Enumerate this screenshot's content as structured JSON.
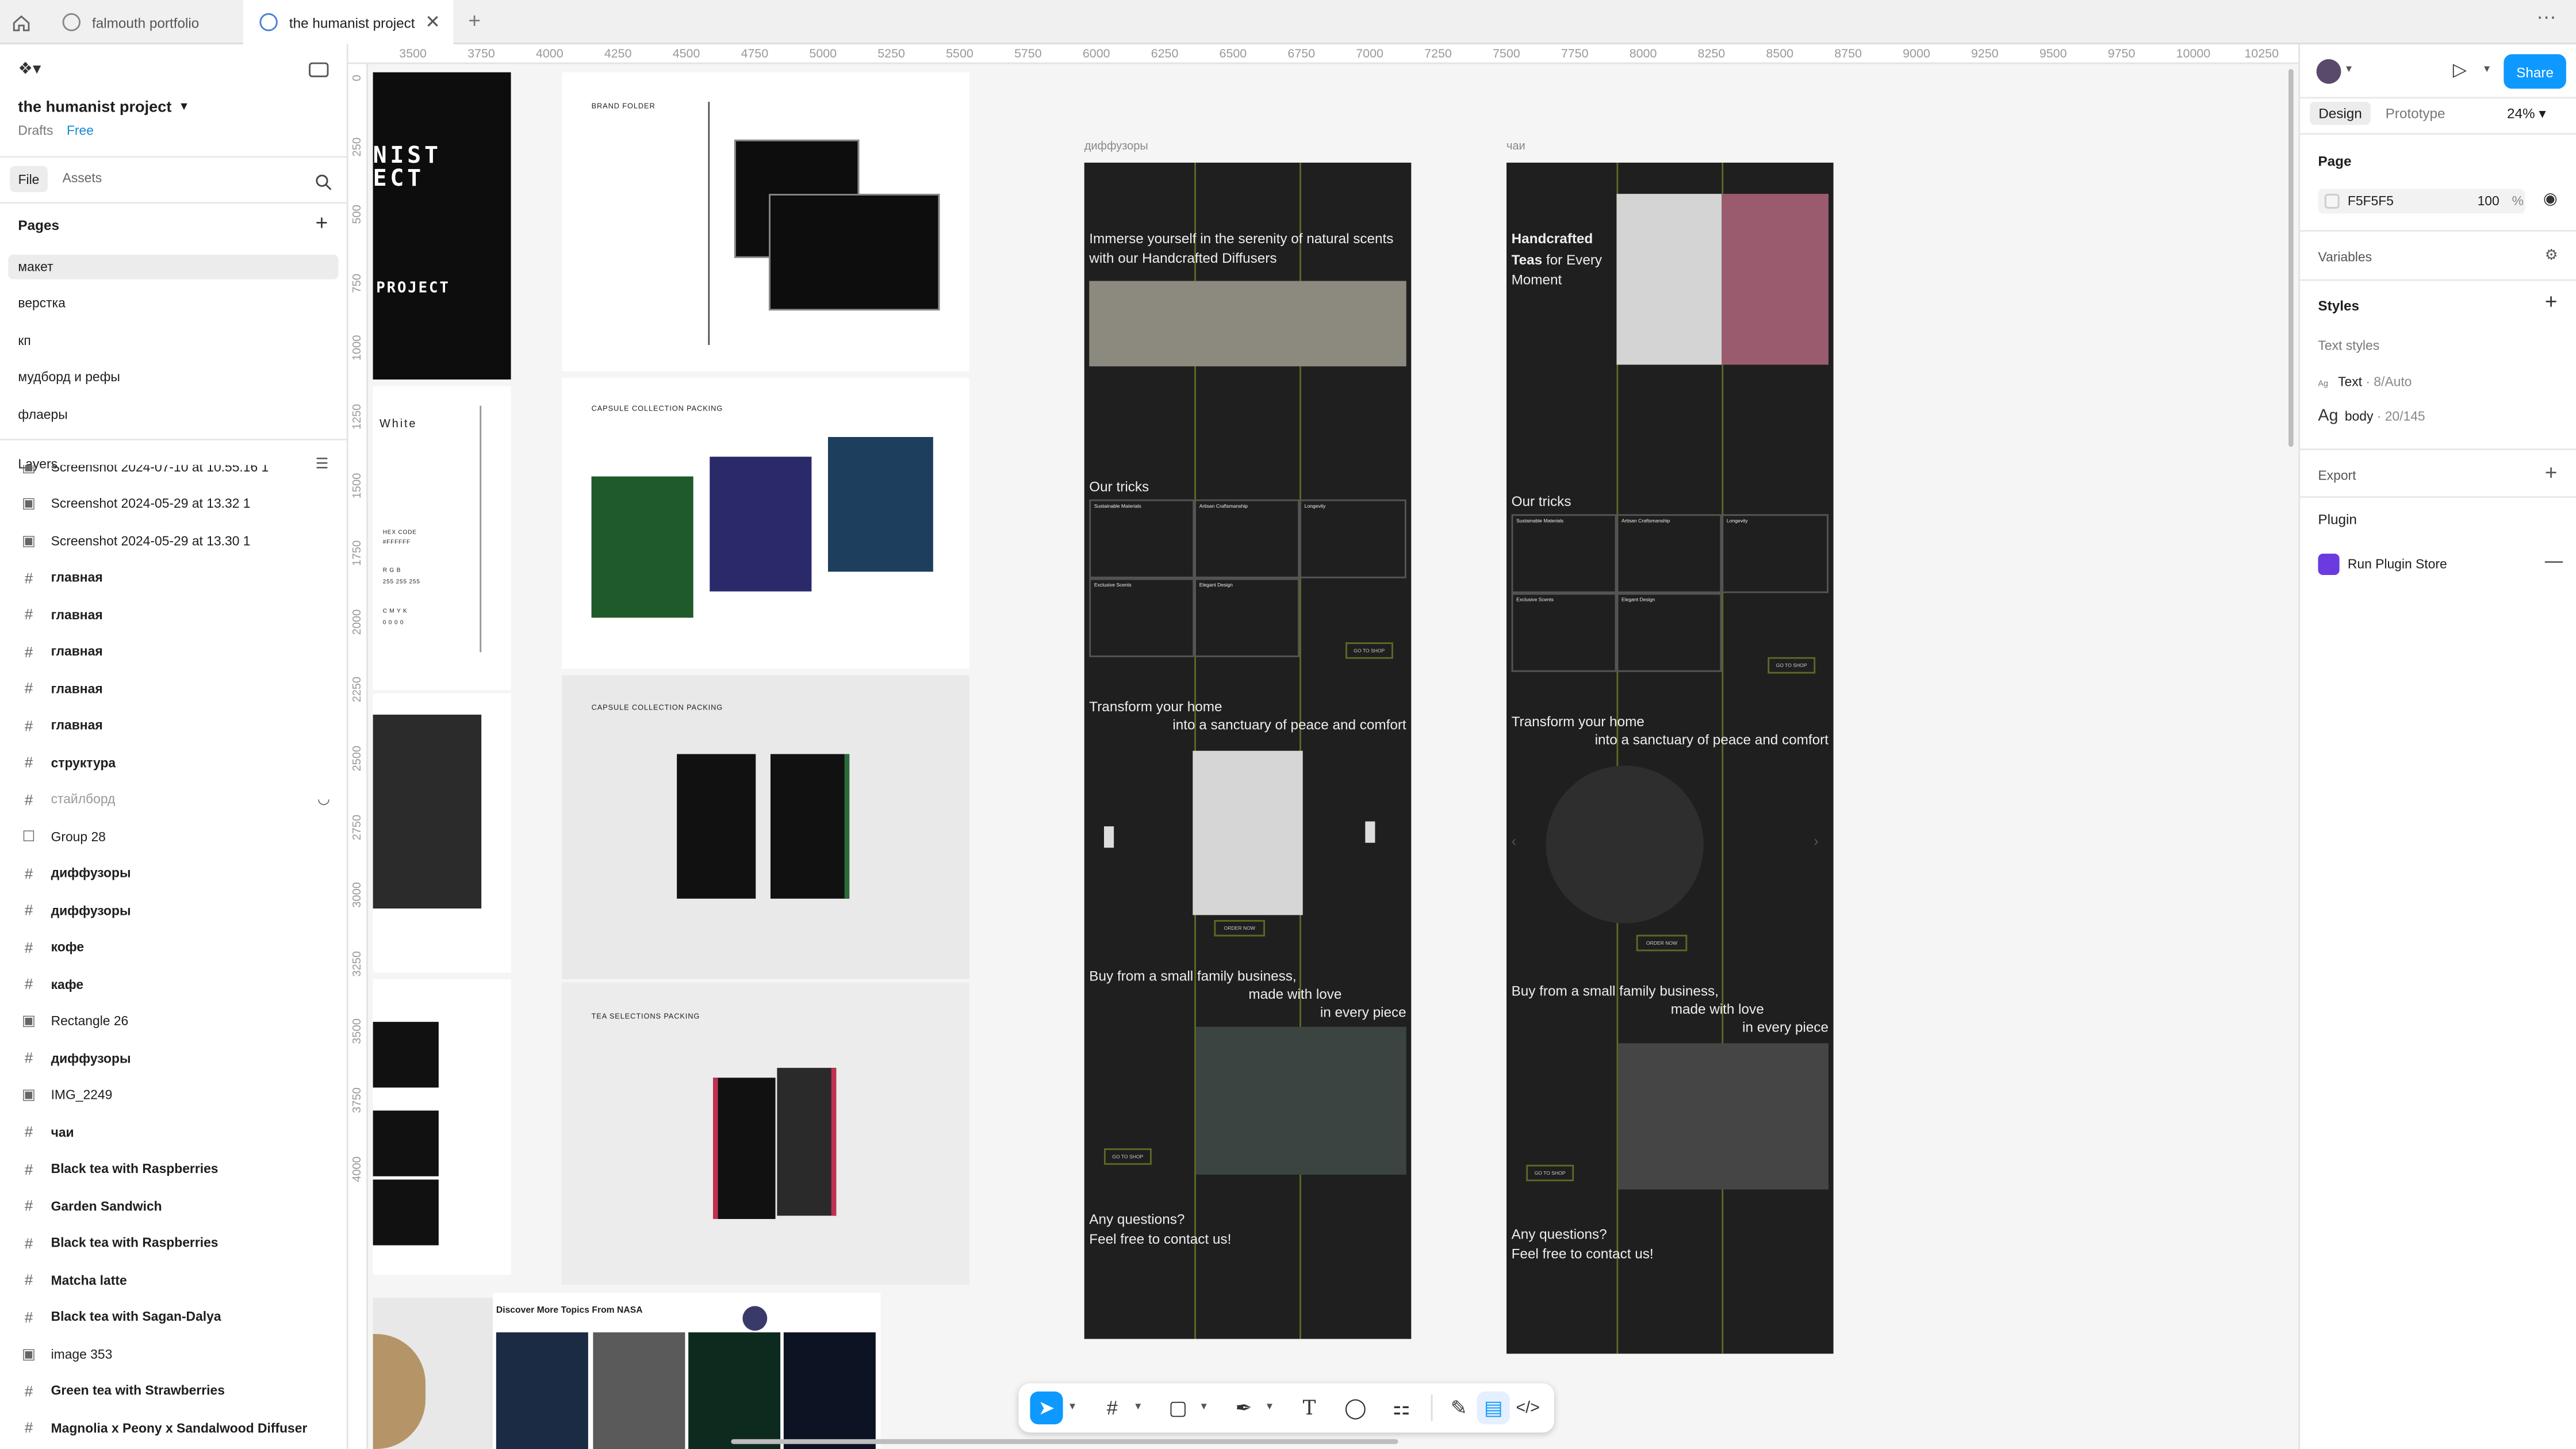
{
  "tabs": [
    {
      "label": "falmouth portfolio"
    },
    {
      "label": "the humanist project"
    }
  ],
  "file": {
    "name": "the humanist project",
    "location": "Drafts",
    "plan": "Free"
  },
  "left_tabs": {
    "file": "File",
    "assets": "Assets"
  },
  "pages_header": "Pages",
  "pages": [
    {
      "label": "макет"
    },
    {
      "label": "верстка"
    },
    {
      "label": "кп"
    },
    {
      "label": "мудборд и рефы"
    },
    {
      "label": "флаеры"
    }
  ],
  "layers_header": "Layers",
  "layers": [
    {
      "label": "Screenshot 2024-07-10 at 10.55.16 1",
      "icon": "image-icon",
      "bold": false
    },
    {
      "label": "Screenshot 2024-05-29 at 13.32 1",
      "icon": "image-icon",
      "bold": false
    },
    {
      "label": "Screenshot 2024-05-29 at 13.30 1",
      "icon": "image-icon",
      "bold": false
    },
    {
      "label": "главная",
      "icon": "frame-icon",
      "bold": true
    },
    {
      "label": "главная",
      "icon": "frame-icon",
      "bold": true
    },
    {
      "label": "главная",
      "icon": "frame-icon",
      "bold": true
    },
    {
      "label": "главная",
      "icon": "frame-icon",
      "bold": true
    },
    {
      "label": "главная",
      "icon": "frame-icon",
      "bold": true
    },
    {
      "label": "структура",
      "icon": "frame-icon",
      "bold": true
    },
    {
      "label": "стайлборд",
      "icon": "frame-icon",
      "bold": false,
      "dim": true
    },
    {
      "label": "Group 28",
      "icon": "group-icon",
      "bold": false
    },
    {
      "label": "диффузоры",
      "icon": "frame-icon",
      "bold": true
    },
    {
      "label": "диффузоры",
      "icon": "frame-icon",
      "bold": true
    },
    {
      "label": "кофе",
      "icon": "frame-icon",
      "bold": true
    },
    {
      "label": "кафе",
      "icon": "frame-icon",
      "bold": true
    },
    {
      "label": "Rectangle 26",
      "icon": "image-icon",
      "bold": false
    },
    {
      "label": "диффузоры",
      "icon": "frame-icon",
      "bold": true
    },
    {
      "label": "IMG_2249",
      "icon": "image-icon",
      "bold": false
    },
    {
      "label": "чаи",
      "icon": "frame-icon",
      "bold": true
    },
    {
      "label": "Black tea with Raspberries",
      "icon": "frame-icon",
      "bold": true
    },
    {
      "label": "Garden Sandwich",
      "icon": "frame-icon",
      "bold": true
    },
    {
      "label": "Black tea with Raspberries",
      "icon": "frame-icon",
      "bold": true
    },
    {
      "label": "Matcha latte",
      "icon": "frame-icon",
      "bold": true
    },
    {
      "label": "Black tea with Sagan-Dalya",
      "icon": "frame-icon",
      "bold": true
    },
    {
      "label": "image 353",
      "icon": "image-icon",
      "bold": false
    },
    {
      "label": "Green tea with Strawberries",
      "icon": "frame-icon",
      "bold": true
    },
    {
      "label": "Magnolia x Peony x Sandalwood Diffuser",
      "icon": "frame-icon",
      "bold": true
    }
  ],
  "ruler_top": [
    "3500",
    "3750",
    "4000",
    "4250",
    "4500",
    "4750",
    "5000",
    "5250",
    "5500",
    "5750",
    "6000",
    "6250",
    "6500",
    "6750",
    "7000",
    "7250",
    "7500",
    "7750",
    "8000",
    "8250",
    "8500",
    "8750",
    "9000",
    "9250",
    "9500",
    "9750",
    "10000",
    "10250"
  ],
  "ruler_left": [
    "0",
    "250",
    "500",
    "750",
    "1000",
    "1250",
    "1500",
    "1750",
    "2000",
    "2250",
    "2500",
    "2750",
    "3000",
    "3250",
    "3500",
    "3750",
    "4000"
  ],
  "right": {
    "share": "Share",
    "design_tab": "Design",
    "prototype_tab": "Prototype",
    "zoom": "24%",
    "page_label": "Page",
    "page_color": "F5F5F5",
    "page_opacity": "100",
    "percent": "%",
    "variables": "Variables",
    "styles": "Styles",
    "text_styles": "Text styles",
    "style1_name": "Text",
    "style1_meta": " · 8/Auto",
    "style2_name": "body",
    "style2_meta": " · 20/145",
    "export": "Export",
    "plugin": "Plugin",
    "plugin_item": "Run Plugin Store",
    "ag": "Ag"
  },
  "canvas": {
    "diffusers_label": "диффузоры",
    "teas_label": "чаи",
    "white": "White",
    "hex_code": "HEX CODE",
    "hex": "#FFFFFF",
    "rgb": "R   G   B",
    "rgb_val": "255  255  255",
    "cmyk": "C  M  Y  K",
    "cmyk_val": "0  0  0  0",
    "brand_folder": "BRAND FOLDER",
    "capsule1": "CAPSULE COLLECTION PACKING",
    "capsule2": "CAPSULE COLLECTION PACKING",
    "tea_sel": "TEA SELECTIONS PACKING",
    "nasa": "Discover More Topics From NASA",
    "d_hero": "Immerse yourself in the serenity of natural scents with our Handcrafted Diffusers",
    "t_hero_1": "Handcrafted",
    "t_hero_2": "Teas",
    "t_hero_3": " for Every Moment",
    "our_tricks": "Our tricks",
    "transform_1": "Transform your home",
    "transform_2": "into a sanctuary of peace and comfort",
    "buy_1": "Buy from a small family business,",
    "buy_2": "made with love",
    "buy_3": "in every piece",
    "questions_1": "Any questions?",
    "questions_2": "Feel free to contact us!",
    "go_to_shop": "GO TO SHOP",
    "order_now": "ORDER NOW",
    "project_mark": "PROJECT",
    "trick_titles": [
      "Sustainable Materials",
      "Artisan Craftsmanship",
      "Longevity",
      "Exclusive Scents",
      "Elegant Design"
    ]
  },
  "help": "?"
}
